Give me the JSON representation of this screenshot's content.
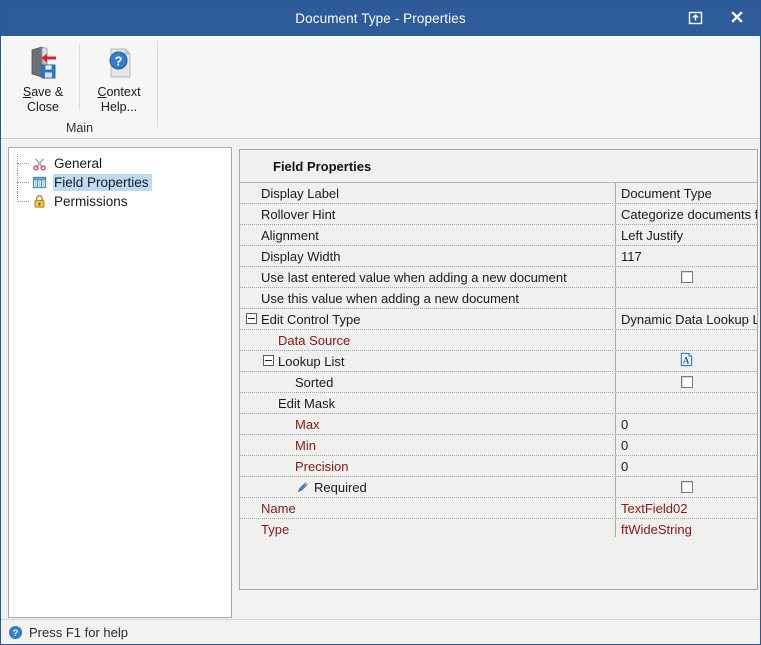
{
  "window": {
    "title": "Document Type - Properties",
    "restore_icon": "restore-up-icon",
    "close_icon": "close-icon"
  },
  "ribbon": {
    "group_title": "Main",
    "buttons": [
      {
        "icon": "save-and-close-icon",
        "line1": "Save &",
        "line2": "Close",
        "accel": "S"
      },
      {
        "icon": "context-help-icon",
        "line1": "Context",
        "line2": "Help...",
        "accel": "C"
      }
    ]
  },
  "tree": {
    "items": [
      {
        "label": "General",
        "icon": "scissors-icon",
        "selected": false
      },
      {
        "label": "Field Properties",
        "icon": "table-grid-icon",
        "selected": true
      },
      {
        "label": "Permissions",
        "icon": "padlock-icon",
        "selected": false
      }
    ]
  },
  "grid": {
    "caption": "Field Properties",
    "rows": [
      {
        "name": "Display Label",
        "level": 0,
        "value": "Document Type",
        "type": "text",
        "name_color": "default"
      },
      {
        "name": "Rollover Hint",
        "level": 0,
        "value": "Categorize documents f",
        "type": "text",
        "name_color": "default"
      },
      {
        "name": "Alignment",
        "level": 0,
        "value": "Left Justify",
        "type": "text",
        "name_color": "default"
      },
      {
        "name": "Display Width",
        "level": 0,
        "value": "117",
        "type": "text",
        "name_color": "default"
      },
      {
        "name": "Use last entered value when adding a new document",
        "level": 0,
        "value": "",
        "type": "checkbox",
        "checked": false,
        "name_color": "default"
      },
      {
        "name": "Use this value when adding a new document",
        "level": 0,
        "value": "",
        "type": "text",
        "name_color": "default"
      },
      {
        "name": "Edit Control Type",
        "level": 0,
        "value": "Dynamic Data Lookup L",
        "type": "text",
        "expander": "collapse",
        "expander_level": 0,
        "name_color": "default"
      },
      {
        "name": "Data Source",
        "level": 1,
        "value": "",
        "type": "text",
        "name_color": "red"
      },
      {
        "name": "Lookup List",
        "level": 1,
        "value": "",
        "type": "page-a-icon",
        "expander": "collapse",
        "expander_level": 1,
        "name_color": "default"
      },
      {
        "name": "Sorted",
        "level": 2,
        "value": "",
        "type": "checkbox",
        "checked": false,
        "name_color": "default"
      },
      {
        "name": "Edit Mask",
        "level": 1,
        "value": "",
        "type": "text",
        "name_color": "default"
      },
      {
        "name": "Max",
        "level": 2,
        "value": "0",
        "type": "text",
        "name_color": "red"
      },
      {
        "name": "Min",
        "level": 2,
        "value": "0",
        "type": "text",
        "name_color": "red"
      },
      {
        "name": "Precision",
        "level": 2,
        "value": "0",
        "type": "text",
        "name_color": "red"
      },
      {
        "name": "Required",
        "level": 2,
        "value": "",
        "type": "checkbox",
        "checked": false,
        "icon": "pencil-icon",
        "name_color": "default"
      },
      {
        "name": "Name",
        "level": 0,
        "value": "TextField02",
        "type": "text",
        "name_color": "red",
        "value_color": "red"
      },
      {
        "name": "Type",
        "level": 0,
        "value": "ftWideString",
        "type": "text",
        "name_color": "red",
        "value_color": "red"
      }
    ]
  },
  "statusbar": {
    "icon": "help-circle-icon",
    "text": "Press F1 for help"
  },
  "colors": {
    "titlebar": "#2e5c9a",
    "selection": "#bcdcf5",
    "red_label": "#8a1616",
    "ribbon_bg": "#f6f6f4",
    "grid_bg": "#f0f0ee"
  }
}
